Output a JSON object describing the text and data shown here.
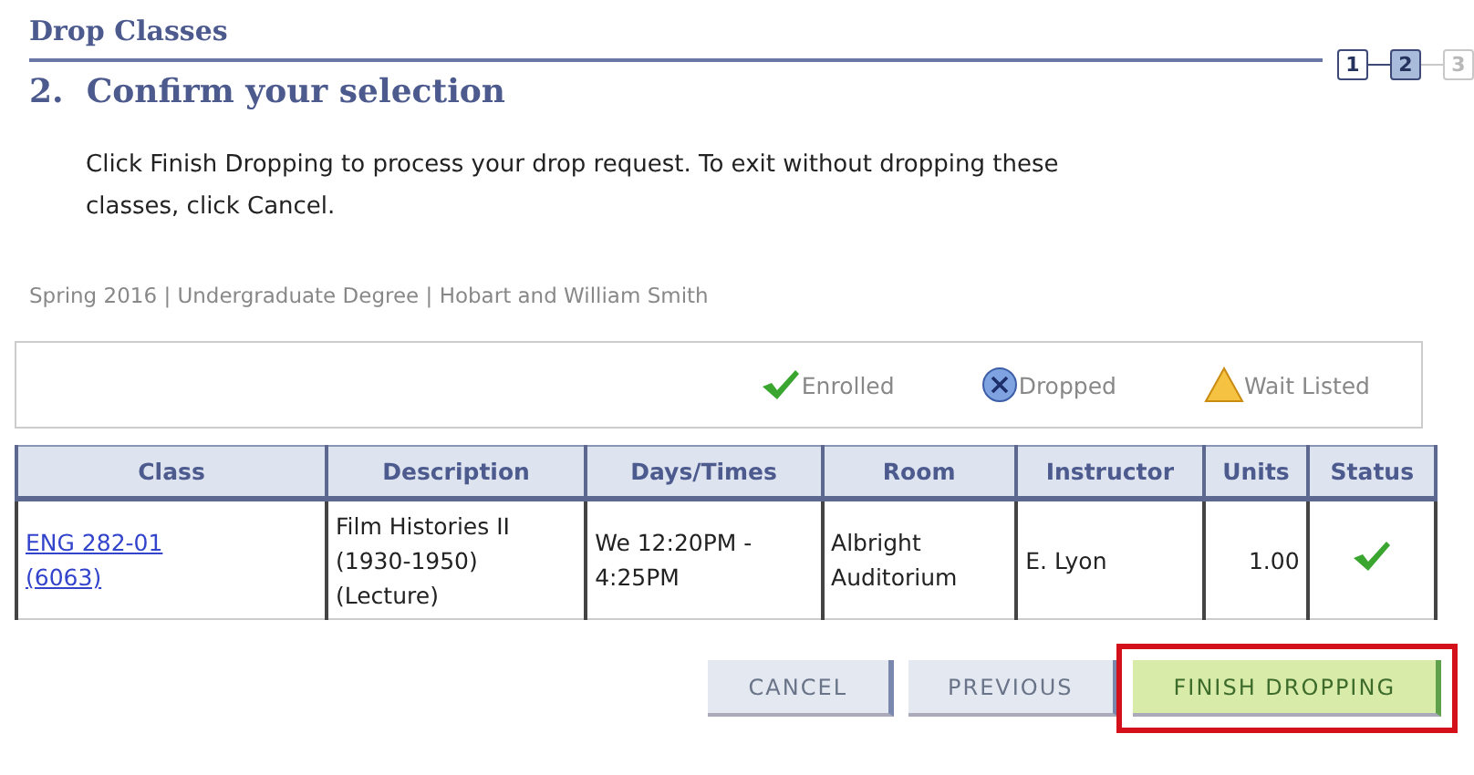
{
  "page_title": "Drop Classes",
  "steps": [
    {
      "label": "1",
      "selected": false,
      "disabled": false
    },
    {
      "label": "2",
      "selected": true,
      "disabled": false
    },
    {
      "label": "3",
      "selected": false,
      "disabled": true
    }
  ],
  "heading": "2.  Confirm your selection",
  "instructions": "Click Finish Dropping to process your drop request. To exit without dropping these classes, click Cancel.",
  "term": "Spring 2016 | Undergraduate Degree | Hobart and William Smith",
  "legend": [
    {
      "kind": "enrolled",
      "label": "Enrolled"
    },
    {
      "kind": "dropped",
      "label": "Dropped"
    },
    {
      "kind": "waitlisted",
      "label": "Wait Listed"
    }
  ],
  "table": {
    "columns": [
      "Class",
      "Description",
      "Days/Times",
      "Room",
      "Instructor",
      "Units",
      "Status"
    ],
    "rows": [
      {
        "class_lines": [
          "ENG 282-01",
          "(6063)"
        ],
        "description_lines": [
          "Film Histories II",
          "(1930-1950)",
          "(Lecture)"
        ],
        "days_times_lines": [
          "We 12:20PM -",
          "4:25PM"
        ],
        "room_lines": [
          "Albright",
          "Auditorium"
        ],
        "instructor": "E. Lyon",
        "units": "1.00",
        "status_icon": {
          "kind": "enrolled"
        }
      }
    ]
  },
  "buttons": [
    {
      "label": "CANCEL",
      "kind": "plain",
      "highlighted": false
    },
    {
      "label": "PREVIOUS",
      "kind": "plain",
      "highlighted": false
    },
    {
      "label": "FINISH DROPPING",
      "kind": "primary",
      "highlighted": true
    }
  ]
}
